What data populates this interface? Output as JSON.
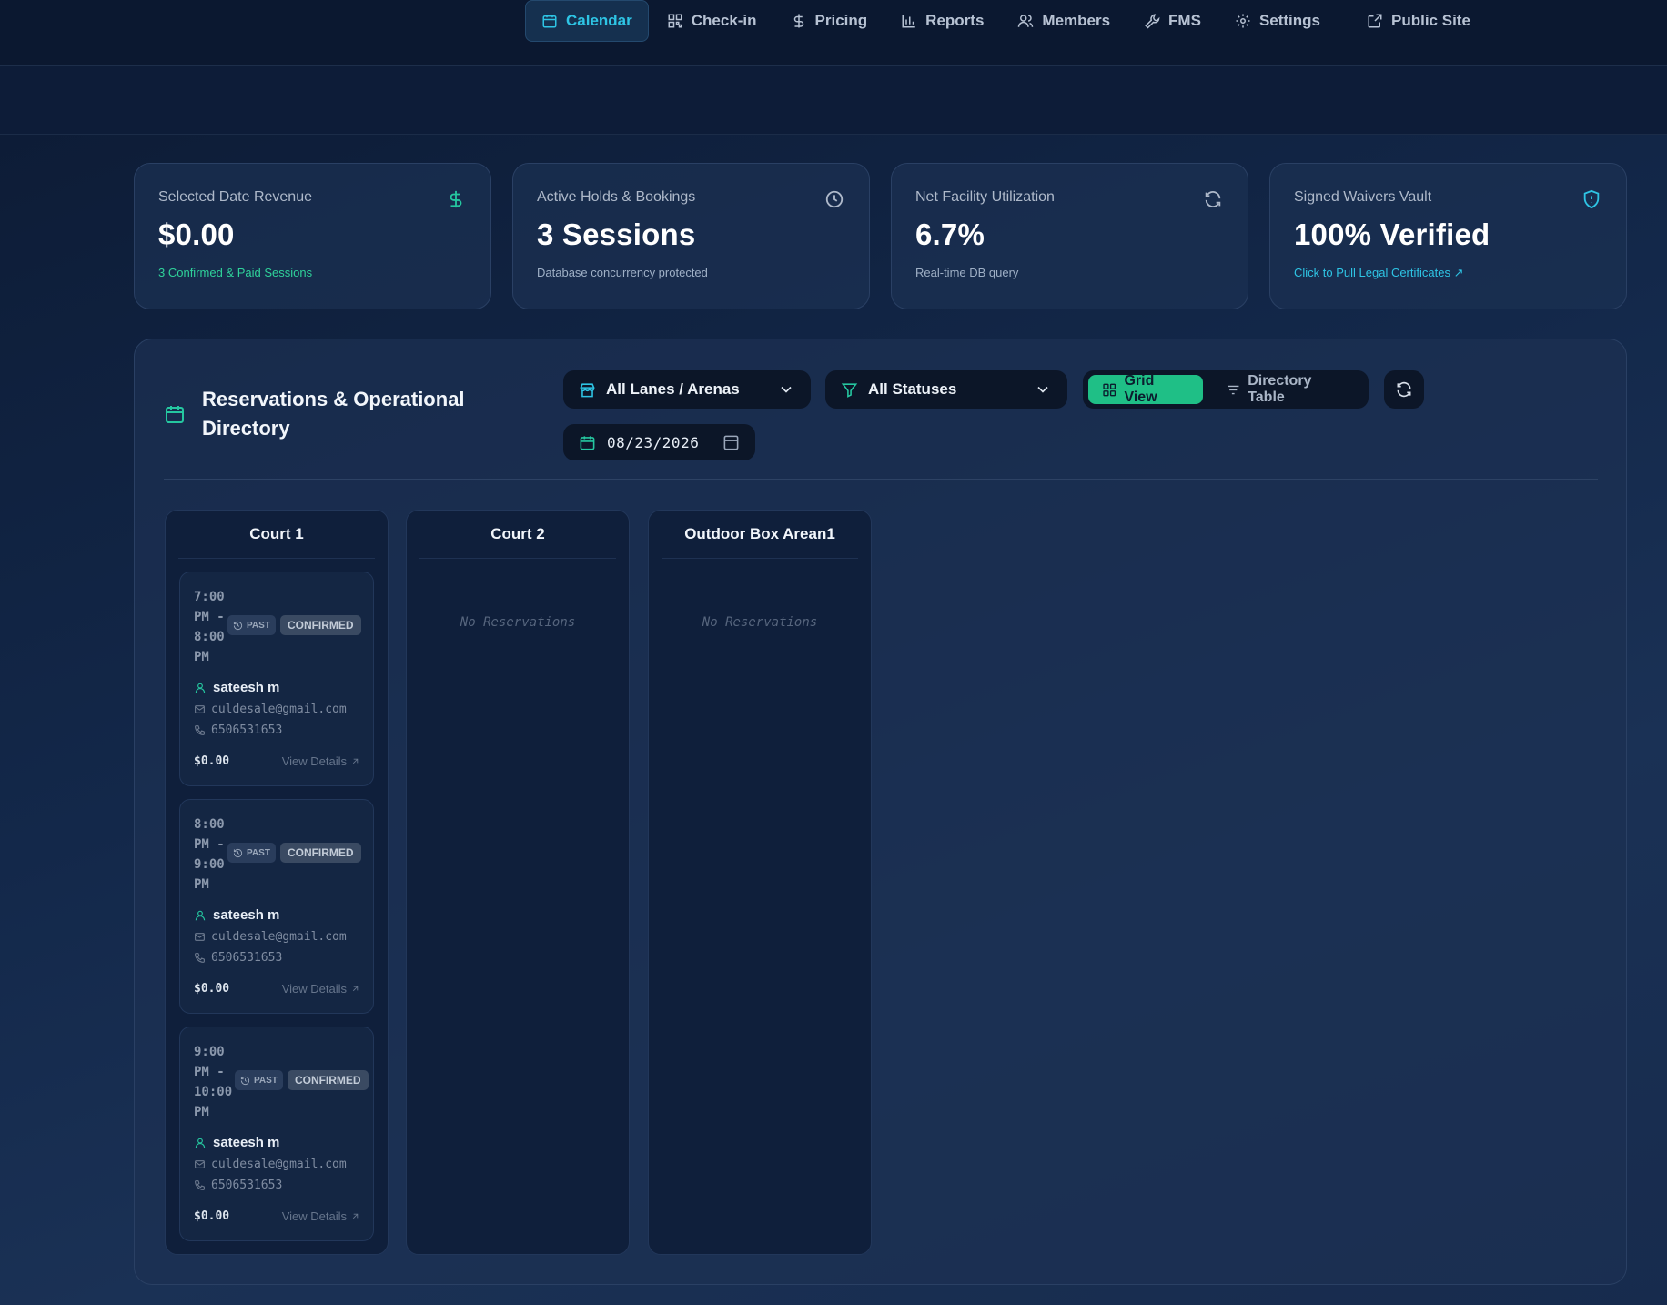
{
  "nav": {
    "items": [
      {
        "label": "Calendar",
        "icon": "calendar-icon",
        "active": true
      },
      {
        "label": "Check-in",
        "icon": "qr-icon"
      },
      {
        "label": "Pricing",
        "icon": "dollar-icon"
      },
      {
        "label": "Reports",
        "icon": "bar-chart-icon"
      },
      {
        "label": "Members",
        "icon": "users-icon"
      },
      {
        "label": "FMS",
        "icon": "wrench-icon"
      },
      {
        "label": "Settings",
        "icon": "gear-icon"
      },
      {
        "label": "Public Site",
        "icon": "external-link-icon"
      }
    ]
  },
  "stats": [
    {
      "label": "Selected Date Revenue",
      "value": "$0.00",
      "sub": "3 Confirmed & Paid Sessions",
      "icon": "dollar-icon",
      "color": "#25c7a0"
    },
    {
      "label": "Active Holds & Bookings",
      "value": "3 Sessions",
      "sub": "Database concurrency protected",
      "icon": "clock-icon",
      "color": "#aeb9ca"
    },
    {
      "label": "Net Facility Utilization",
      "value": "6.7%",
      "sub": "Real-time DB query",
      "icon": "refresh-icon",
      "color": "#aeb9ca"
    },
    {
      "label": "Signed Waivers Vault",
      "value": "100% Verified",
      "sub": "Click to Pull Legal Certificates",
      "icon": "shield-icon",
      "color": "#2ec4e4"
    }
  ],
  "directory": {
    "title": "Reservations & Operational Directory",
    "lanes_filter": "All Lanes / Arenas",
    "status_filter": "All Statuses",
    "grid_view_label": "Grid View",
    "table_view_label": "Directory Table",
    "date": "08/23/2026"
  },
  "columns": [
    {
      "name": "Court 1"
    },
    {
      "name": "Court 2",
      "empty": "No Reservations"
    },
    {
      "name": "Outdoor Box Arean1",
      "empty": "No Reservations"
    }
  ],
  "reservations": [
    {
      "time": "7:00 PM - 8:00 PM",
      "past": "PAST",
      "status": "CONFIRMED",
      "name": "sateesh m",
      "email": "culdesale@gmail.com",
      "phone": "6506531653",
      "amount": "$0.00",
      "link": "View Details"
    },
    {
      "time": "8:00 PM - 9:00 PM",
      "past": "PAST",
      "status": "CONFIRMED",
      "name": "sateesh m",
      "email": "culdesale@gmail.com",
      "phone": "6506531653",
      "amount": "$0.00",
      "link": "View Details"
    },
    {
      "time": "9:00 PM - 10:00 PM",
      "past": "PAST",
      "status": "CONFIRMED",
      "name": "sateesh m",
      "email": "culdesale@gmail.com",
      "phone": "6506531653",
      "amount": "$0.00",
      "link": "View Details"
    }
  ],
  "colors": {
    "accent_cyan": "#2ec4e4",
    "accent_green": "#1fbf86",
    "background": "#13284a"
  }
}
